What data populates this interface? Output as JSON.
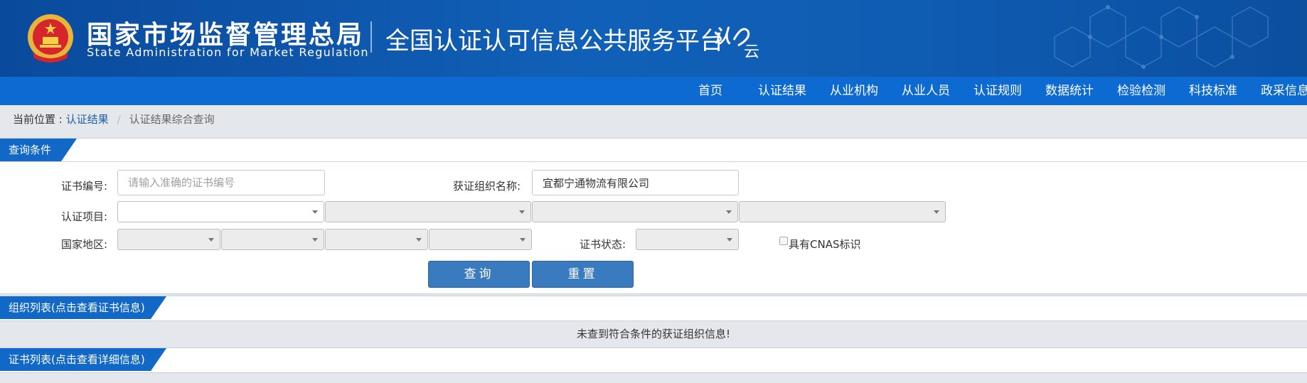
{
  "header": {
    "org_name_cn": "国家市场监督管理总局",
    "org_name_en": "State Administration  for  Market Regulation",
    "platform_title": "全国认证认可信息公共服务平台",
    "logo_text_1": "认",
    "logo_text_2": "云"
  },
  "nav": {
    "items": [
      "首页",
      "认证结果",
      "从业机构",
      "从业人员",
      "认证规则",
      "数据统计",
      "检验检测",
      "科技标准",
      "政采信息"
    ]
  },
  "breadcrumb": {
    "label": "当前位置 : ",
    "link": "认证结果",
    "separator": "/",
    "current": "认证结果综合查询"
  },
  "query_panel": {
    "title": "查询条件",
    "cert_no_label": "证书编号:",
    "cert_no_placeholder": "请输入准确的证书编号",
    "cert_no_value": "",
    "org_name_label": "获证组织名称:",
    "org_name_value": "宜都宁通物流有限公司",
    "project_label": "认证项目:",
    "region_label": "国家地区:",
    "status_label": "证书状态:",
    "cnas_label": "具有CNAS标识",
    "search_button": "查询",
    "reset_button": "重置"
  },
  "org_list": {
    "title": "组织列表(点击查看证书信息)",
    "empty_message": "未查到符合条件的获证组织信息!"
  },
  "cert_list": {
    "title": "证书列表(点击查看详细信息)"
  },
  "colors": {
    "header_blue": "#0f5cb3",
    "nav_blue": "#0d6ad0",
    "tab_blue": "#1268c6",
    "button_blue": "#3a7bbf",
    "page_bg": "#e4e8ec"
  }
}
